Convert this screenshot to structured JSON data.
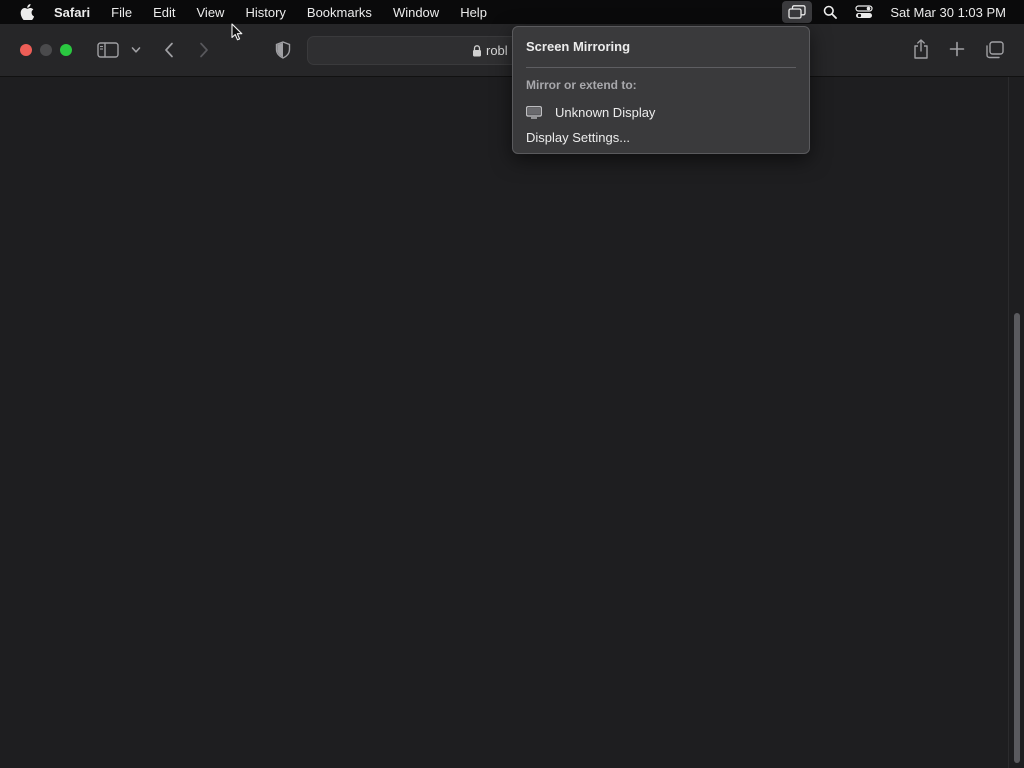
{
  "menubar": {
    "apple_icon": "apple-logo-icon",
    "app_name": "Safari",
    "items": [
      "File",
      "Edit",
      "View",
      "History",
      "Bookmarks",
      "Window",
      "Help"
    ],
    "status_icons": [
      "screen-mirroring-icon",
      "search-icon",
      "control-center-icon"
    ],
    "clock": "Sat Mar 30  1:03 PM"
  },
  "toolbar": {
    "address_text": "robl",
    "icons": [
      "sidebar-icon",
      "chevron-down-icon",
      "back-chevron-icon",
      "forward-chevron-icon",
      "shield-icon",
      "lock-icon",
      "share-icon",
      "plus-icon",
      "tabs-overview-icon"
    ]
  },
  "popover": {
    "title": "Screen Mirroring",
    "subtitle": "Mirror or extend to:",
    "device": {
      "icon": "display-icon",
      "label": "Unknown Display"
    },
    "settings_label": "Display Settings..."
  },
  "colors": {
    "close": "#ed5e57",
    "minimize": "#4a4a4c",
    "zoom": "#2ac840",
    "background": "#1e1e20",
    "popover": "#3a3a3c"
  }
}
